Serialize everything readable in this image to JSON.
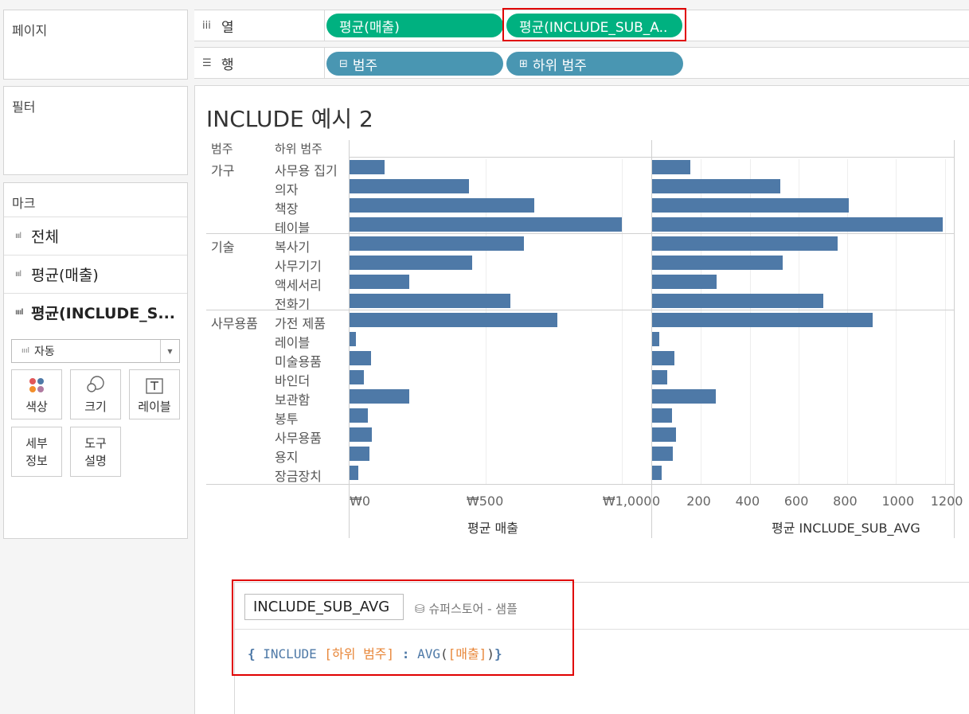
{
  "left": {
    "pages_title": "페이지",
    "filters_title": "필터",
    "marks": {
      "title": "마크",
      "rows": [
        {
          "label": "전체",
          "icon": "bar-chart-icon"
        },
        {
          "label": "평균(매출)",
          "icon": "bar-chart-icon"
        },
        {
          "label": "평균(INCLUDE_S...",
          "icon": "bar-chart-icon"
        }
      ],
      "mark_type": "자동",
      "buttons": [
        {
          "label": "색상",
          "icon": "color-dots-icon"
        },
        {
          "label": "크기",
          "icon": "size-icon"
        },
        {
          "label": "레이블",
          "icon": "text-label-icon"
        },
        {
          "label1": "세부",
          "label2": "정보"
        },
        {
          "label1": "도구",
          "label2": "설명"
        }
      ]
    }
  },
  "shelves": {
    "columns": {
      "label": "열",
      "icon": "iii",
      "pills": [
        "평균(매출)",
        "평균(INCLUDE_SUB_A.."
      ]
    },
    "rows": {
      "label": "행",
      "icon": "☰",
      "pills": [
        "범주",
        "하위 범주"
      ]
    }
  },
  "sheet": {
    "title": "INCLUDE 예시 2",
    "header_category": "범주",
    "header_subcategory": "하위 범주"
  },
  "chart_data": [
    {
      "type": "bar",
      "orientation": "horizontal",
      "categories": [
        "가구",
        "기술",
        "사무용품"
      ],
      "rows": [
        {
          "category": "가구",
          "subcategory": "사무용 집기"
        },
        {
          "category": "가구",
          "subcategory": "의자"
        },
        {
          "category": "가구",
          "subcategory": "책장"
        },
        {
          "category": "가구",
          "subcategory": "테이블"
        },
        {
          "category": "기술",
          "subcategory": "복사기"
        },
        {
          "category": "기술",
          "subcategory": "사무기기"
        },
        {
          "category": "기술",
          "subcategory": "액세서리"
        },
        {
          "category": "기술",
          "subcategory": "전화기"
        },
        {
          "category": "사무용품",
          "subcategory": "가전 제품"
        },
        {
          "category": "사무용품",
          "subcategory": "레이블"
        },
        {
          "category": "사무용품",
          "subcategory": "미술용품"
        },
        {
          "category": "사무용품",
          "subcategory": "바인더"
        },
        {
          "category": "사무용품",
          "subcategory": "보관함"
        },
        {
          "category": "사무용품",
          "subcategory": "봉투"
        },
        {
          "category": "사무용품",
          "subcategory": "사무용품"
        },
        {
          "category": "사무용품",
          "subcategory": "용지"
        },
        {
          "category": "사무용품",
          "subcategory": "장금장치"
        }
      ],
      "series": [
        {
          "axis_title": "평균 매출",
          "values": [
            130,
            440,
            680,
            1000,
            640,
            450,
            220,
            590,
            765,
            22,
            78,
            52,
            218,
            66,
            82,
            72,
            33
          ],
          "xlim": [
            0,
            1100
          ],
          "ticks": [
            {
              "value": 0,
              "label": "₩0"
            },
            {
              "value": 500,
              "label": "₩500"
            },
            {
              "value": 1000,
              "label": "₩1,000"
            }
          ]
        },
        {
          "axis_title": "평균 INCLUDE_SUB_AVG",
          "values": [
            155,
            525,
            805,
            1190,
            760,
            535,
            265,
            700,
            905,
            28,
            92,
            62,
            260,
            80,
            98,
            86,
            40
          ],
          "xlim": [
            0,
            1240
          ],
          "ticks": [
            {
              "value": 0,
              "label": "0"
            },
            {
              "value": 200,
              "label": "200"
            },
            {
              "value": 400,
              "label": "400"
            },
            {
              "value": 600,
              "label": "600"
            },
            {
              "value": 800,
              "label": "800"
            },
            {
              "value": 1000,
              "label": "1000"
            },
            {
              "value": 1200,
              "label": "1200"
            }
          ]
        }
      ],
      "bar_color": "#4e79a7",
      "grid": true
    }
  ],
  "calc": {
    "name": "INCLUDE_SUB_AVG",
    "source": "슈퍼스토어 - 샘플",
    "formula": {
      "open": "{",
      "keyword": "INCLUDE",
      "field1": "[하위 범주]",
      "colon": ":",
      "func": "AVG",
      "lparen": "(",
      "field2": "[매출]",
      "rparen": ")",
      "close": "}"
    }
  },
  "colors": {
    "green_pill": "#00b180",
    "blue_pill": "#4996b2",
    "highlight": "#e00000"
  }
}
